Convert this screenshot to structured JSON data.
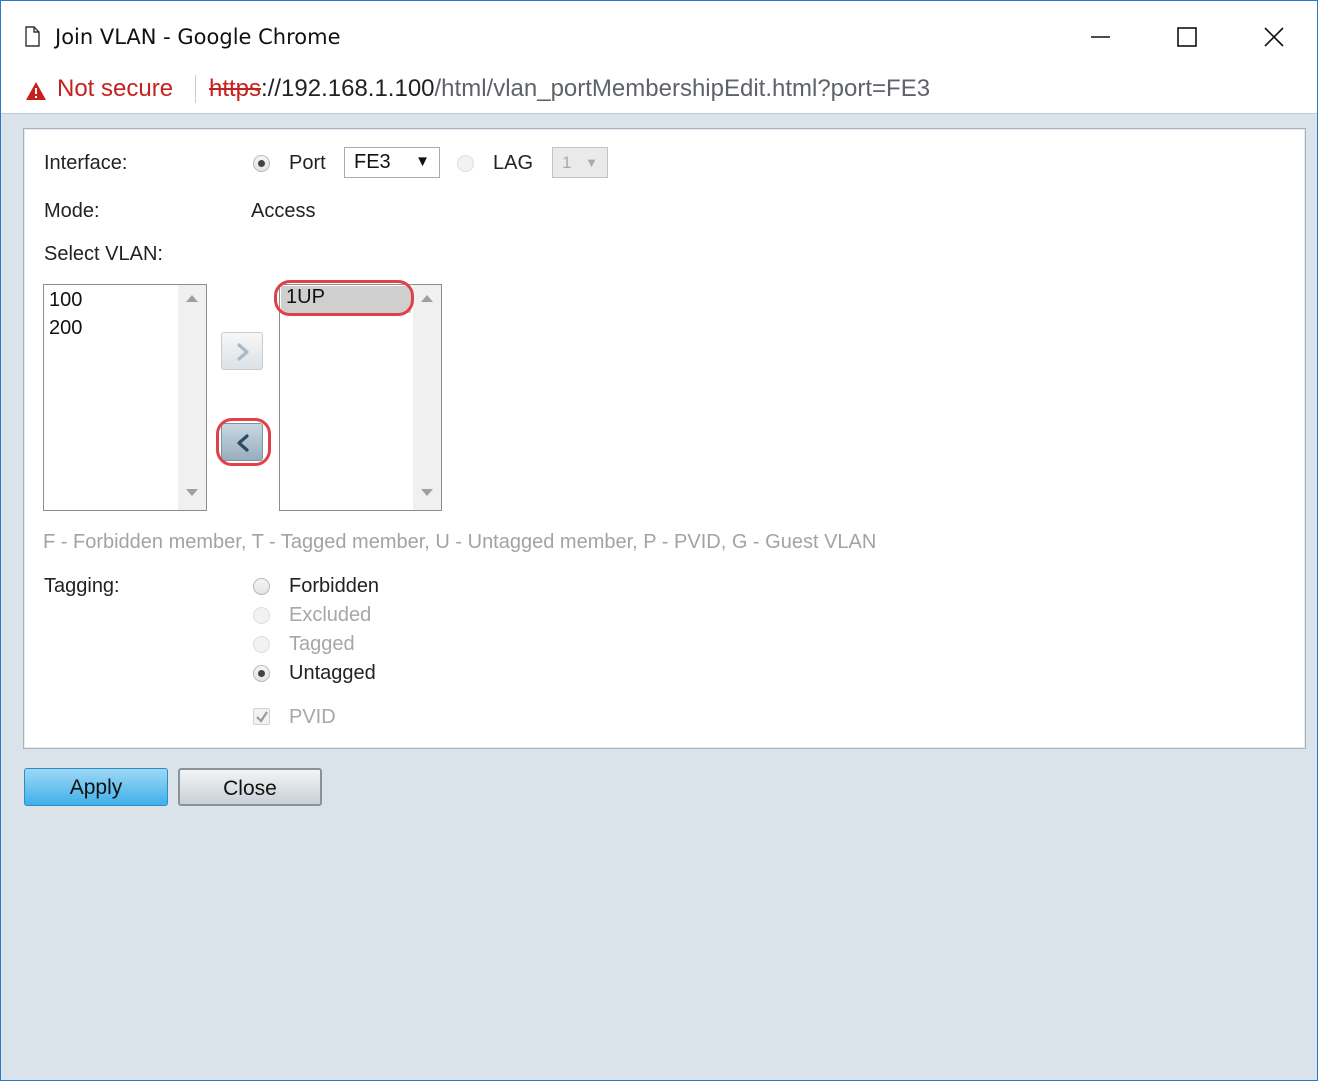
{
  "window": {
    "title": "Join VLAN - Google Chrome",
    "controls": {
      "minimize": "minimize",
      "maximize": "maximize",
      "close": "close"
    }
  },
  "address_bar": {
    "security_label": "Not secure",
    "url_scheme": "https",
    "url_host_part": "://192.168.1.100",
    "url_path": "/html/vlan_portMembershipEdit.html?port=FE3"
  },
  "form": {
    "interface_label": "Interface:",
    "port_label": "Port",
    "port_selected": true,
    "port_value": "FE3",
    "lag_label": "LAG",
    "lag_selected": false,
    "lag_value": "1",
    "mode_label": "Mode:",
    "mode_value": "Access",
    "select_vlan_label": "Select VLAN:",
    "available_vlans": [
      "100",
      "200"
    ],
    "member_vlans": [
      "1UP"
    ],
    "selected_member": "1UP",
    "legend": "F - Forbidden member, T - Tagged member, U - Untagged member, P - PVID, G - Guest VLAN",
    "tagging_label": "Tagging:",
    "tagging_options": [
      {
        "label": "Forbidden",
        "checked": false,
        "disabled": false
      },
      {
        "label": "Excluded",
        "checked": false,
        "disabled": true
      },
      {
        "label": "Tagged",
        "checked": false,
        "disabled": true
      },
      {
        "label": "Untagged",
        "checked": true,
        "disabled": false
      }
    ],
    "pvid_label": "PVID",
    "pvid_checked": true,
    "pvid_disabled": true
  },
  "buttons": {
    "apply": "Apply",
    "close": "Close"
  },
  "colors": {
    "highlight": "#e0404a",
    "apply_button": "#3fb0e8",
    "not_secure": "#c5221f"
  }
}
